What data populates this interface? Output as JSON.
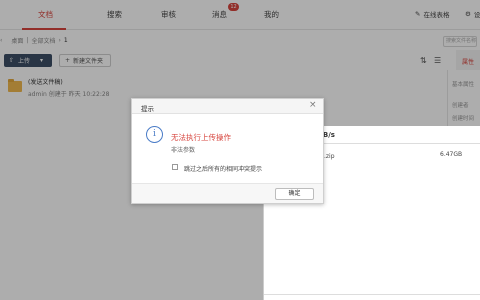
{
  "nav": {
    "tabs": [
      {
        "label": "文档"
      },
      {
        "label": "搜索"
      },
      {
        "label": "审核"
      },
      {
        "label": "消息"
      },
      {
        "label": "我的"
      }
    ],
    "message_badge": "12",
    "online_forms": "在线表格",
    "settings_label": "设"
  },
  "breadcrumb": {
    "root": "桌面",
    "parent": "全部文档",
    "current": "1"
  },
  "search": {
    "placeholder": "搜索文件名称"
  },
  "toolbar": {
    "upload_label": "上传",
    "new_folder_label": "新建文件夹"
  },
  "side": {
    "tab": "属性",
    "basic": "基本属性",
    "created_by": "创建者",
    "created_time": "创建时间"
  },
  "files": [
    {
      "name": "(发送文件稿)",
      "meta": "admin 创建于 昨天 10:22:28"
    }
  ],
  "upload_panel": {
    "speed": "0B/s",
    "file_name": "件.zip",
    "file_size": "6.47GB"
  },
  "dialog": {
    "title": "提示",
    "message": "无法执行上传操作",
    "sub": "非法参数",
    "checkbox_label": "跳过之后所有的相同冲突提示",
    "ok_label": "确定"
  }
}
